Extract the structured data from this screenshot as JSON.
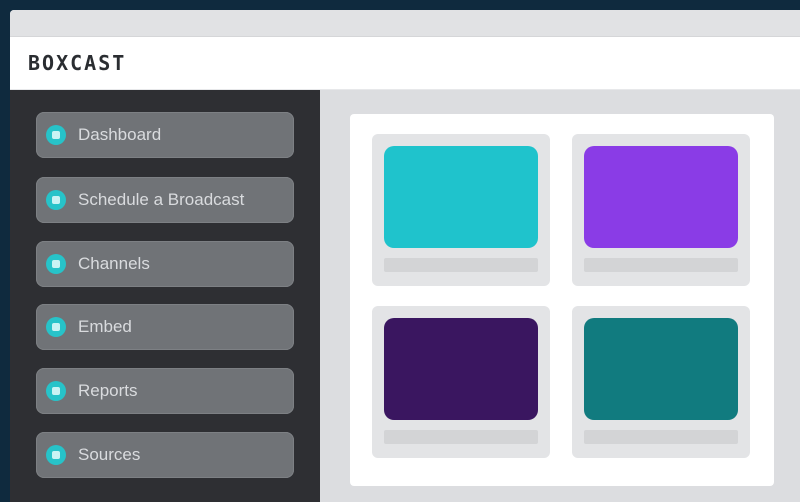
{
  "window": {
    "title": ""
  },
  "header": {
    "logo": "BOXCAST"
  },
  "sidebar": {
    "items": [
      {
        "label": "Dashboard",
        "icon": "broadcast-icon"
      },
      {
        "label": "Schedule a Broadcast",
        "icon": "calendar-icon"
      },
      {
        "label": "Channels",
        "icon": "channels-icon"
      },
      {
        "label": "Embed",
        "icon": "embed-icon"
      },
      {
        "label": "Reports",
        "icon": "reports-icon"
      },
      {
        "label": "Sources",
        "icon": "sources-icon"
      }
    ]
  },
  "main": {
    "cards": [
      {
        "color": "#1fc3cc"
      },
      {
        "color": "#8a3ce6"
      },
      {
        "color": "#3a1660"
      },
      {
        "color": "#117b7f"
      }
    ]
  },
  "colors": {
    "accent": "#27c3c9",
    "sidebar_bg": "#2e2f33",
    "nav_item_bg": "#707377",
    "outer_bg": "#0f2a3e"
  }
}
